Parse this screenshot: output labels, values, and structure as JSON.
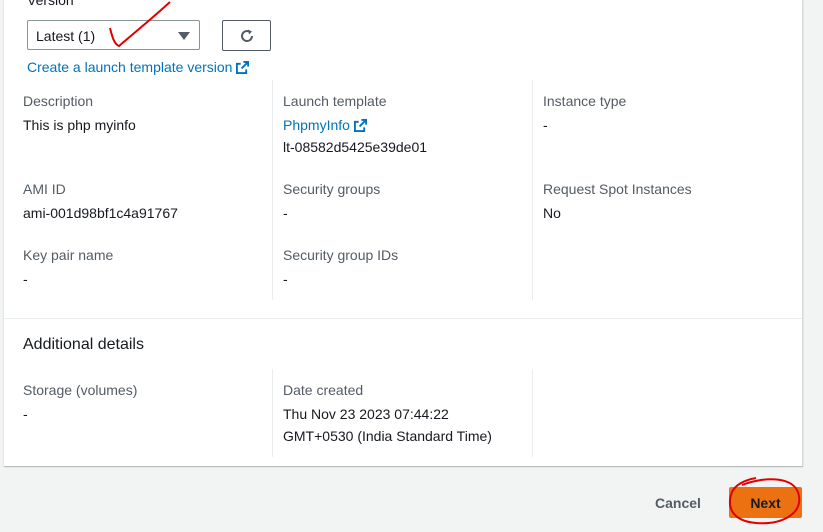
{
  "version": {
    "label": "Version",
    "selected": "Latest (1)",
    "refresh_icon": "refresh-icon"
  },
  "create_version_link": "Create a launch template version",
  "details": {
    "description": {
      "label": "Description",
      "value": "This is php myinfo"
    },
    "launch_template": {
      "label": "Launch template",
      "name": "PhpmyInfo",
      "id": "lt-08582d5425e39de01"
    },
    "instance_type": {
      "label": "Instance type",
      "value": "-"
    },
    "ami_id": {
      "label": "AMI ID",
      "value": "ami-001d98bf1c4a91767"
    },
    "security_groups": {
      "label": "Security groups",
      "value": "-"
    },
    "request_spot": {
      "label": "Request Spot Instances",
      "value": "No"
    },
    "key_pair": {
      "label": "Key pair name",
      "value": "-"
    },
    "security_group_ids": {
      "label": "Security group IDs",
      "value": "-"
    }
  },
  "additional": {
    "title": "Additional details",
    "storage": {
      "label": "Storage (volumes)",
      "value": "-"
    },
    "date_created": {
      "label": "Date created",
      "line1": "Thu Nov 23 2023 07:44:22",
      "line2": "GMT+0530 (India Standard Time)"
    }
  },
  "footer": {
    "cancel_label": "Cancel",
    "next_label": "Next"
  },
  "colors": {
    "link": "#0073bb",
    "primary_button": "#ec7211",
    "annotation": "#e00000"
  }
}
